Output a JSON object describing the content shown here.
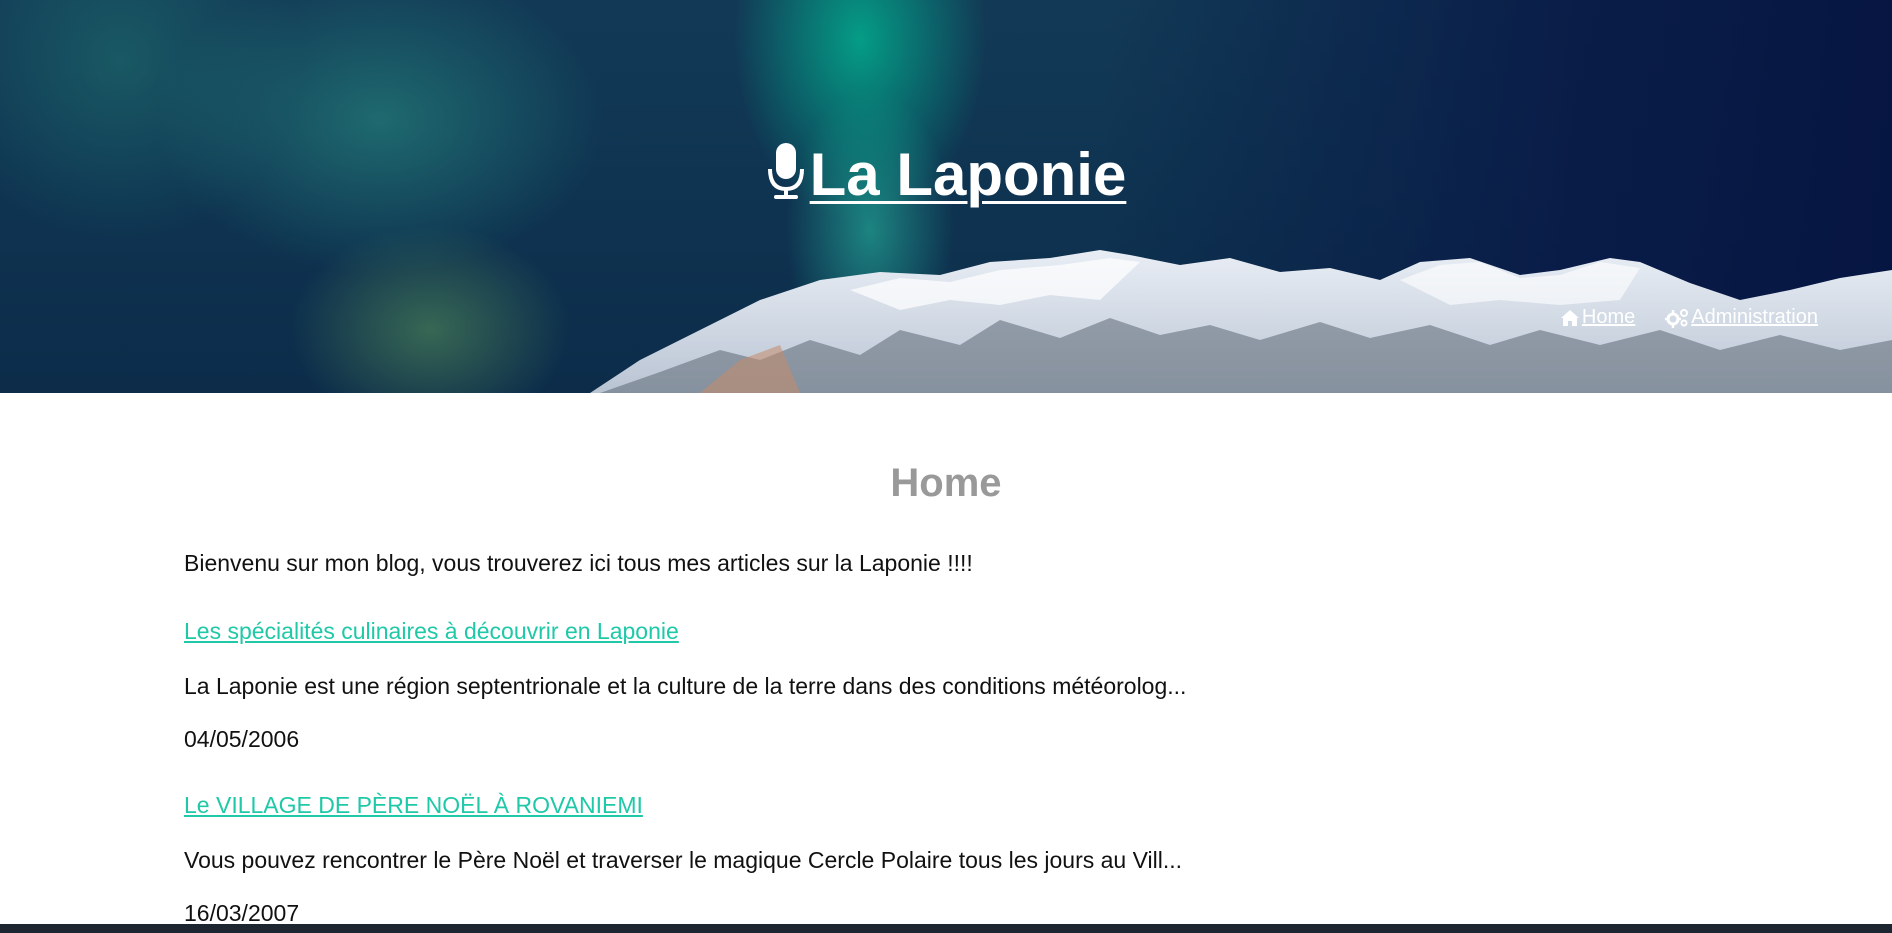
{
  "header": {
    "title": "La Laponie",
    "title_icon": "microphone-icon",
    "nav": [
      {
        "label": "Home",
        "icon": "home-icon"
      },
      {
        "label": "Administration",
        "icon": "gears-icon"
      }
    ]
  },
  "main": {
    "heading": "Home",
    "intro": "Bienvenu sur mon blog, vous trouverez ici tous mes articles sur la Laponie !!!!",
    "articles": [
      {
        "title": "Les spécialités culinaires à découvrir en Laponie",
        "excerpt": "La Laponie est une région septentrionale et la culture de la terre dans des conditions météorolog...",
        "date": "04/05/2006"
      },
      {
        "title": "Le VILLAGE DE PÈRE NOËL À ROVANIEMI",
        "excerpt": "Vous pouvez rencontrer le Père Noël et traverser le magique Cercle Polaire tous les jours au Vill...",
        "date": "16/03/2007"
      }
    ]
  },
  "colors": {
    "link": "#1fc9a8",
    "heading": "#999999",
    "text": "#111111"
  }
}
